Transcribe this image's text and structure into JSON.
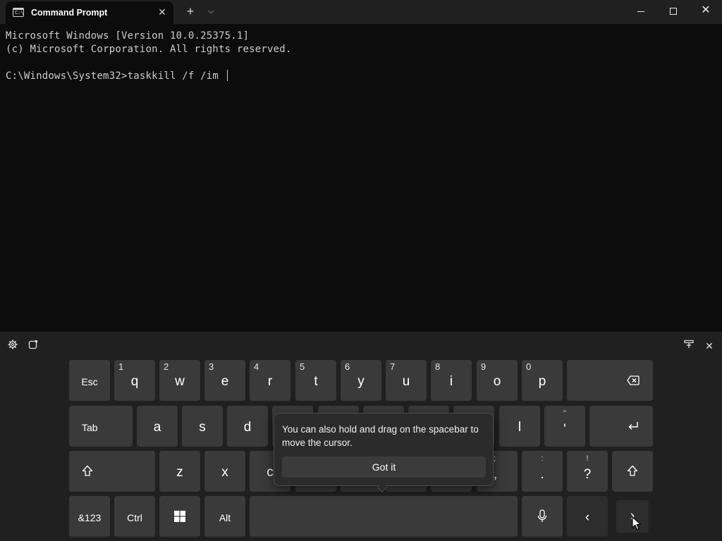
{
  "window": {
    "tab_title": "Command Prompt",
    "tab_icon": "cmd-icon",
    "new_tab_glyph": "+",
    "dropdown_glyph": "⌵",
    "close_tab_glyph": "✕",
    "close_glyph": "✕"
  },
  "terminal": {
    "lines": [
      "Microsoft Windows [Version 10.0.25375.1]",
      "(c) Microsoft Corporation. All rights reserved.",
      "",
      "C:\\Windows\\System32>taskkill /f /im "
    ],
    "text_color": "#cccccc",
    "background": "#0c0c0c"
  },
  "keyboard": {
    "settings_icon": "gear-icon",
    "sticker_icon": "emoji-icon",
    "dock_icon": "dock-icon",
    "close_icon": "close-icon",
    "row1": [
      {
        "label": "Esc"
      },
      {
        "label": "q",
        "alt": "1"
      },
      {
        "label": "w",
        "alt": "2"
      },
      {
        "label": "e",
        "alt": "3"
      },
      {
        "label": "r",
        "alt": "4"
      },
      {
        "label": "t",
        "alt": "5"
      },
      {
        "label": "y",
        "alt": "6"
      },
      {
        "label": "u",
        "alt": "7"
      },
      {
        "label": "i",
        "alt": "8"
      },
      {
        "label": "o",
        "alt": "9"
      },
      {
        "label": "p",
        "alt": "0"
      },
      {
        "label": "⌫",
        "icon": "backspace-icon"
      }
    ],
    "row2": [
      {
        "label": "Tab"
      },
      {
        "label": "a"
      },
      {
        "label": "s"
      },
      {
        "label": "d"
      },
      {
        "label": "l"
      },
      {
        "label": "'",
        "top": "\""
      },
      {
        "label": "↵",
        "icon": "enter-icon"
      }
    ],
    "row3": [
      {
        "label": "⇧",
        "icon": "shift-icon"
      },
      {
        "label": "z"
      },
      {
        "label": "x"
      },
      {
        "label": "c"
      },
      {
        "label": ",",
        "top": ";"
      },
      {
        "label": ".",
        "top": ":"
      },
      {
        "label": "?",
        "top": "!"
      },
      {
        "label": "⇧",
        "icon": "shift-icon"
      }
    ],
    "row4": [
      {
        "label": "&123"
      },
      {
        "label": "Ctrl"
      },
      {
        "label": "",
        "icon": "windows-icon"
      },
      {
        "label": "Alt"
      },
      {
        "label": "",
        "icon": "spacebar"
      },
      {
        "label": "",
        "icon": "microphone-icon"
      },
      {
        "label": "‹",
        "icon": "left-arrow-icon"
      },
      {
        "label": "›",
        "icon": "right-arrow-icon"
      }
    ],
    "background": "#202020",
    "key_color": "#3a3a3a"
  },
  "tooltip": {
    "text": "You can also hold and drag on the spacebar to move the cursor.",
    "button": "Got it"
  }
}
